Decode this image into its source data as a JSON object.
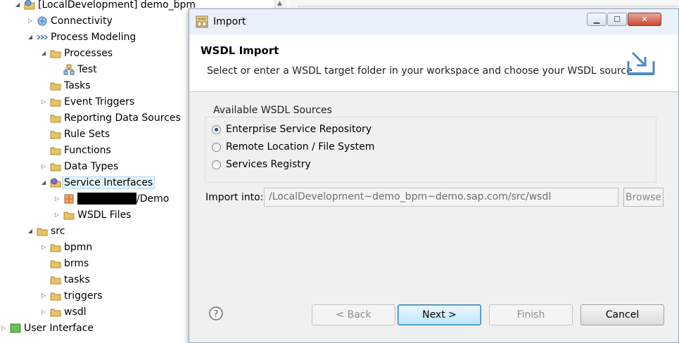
{
  "tree": {
    "items": [
      {
        "label": "[LocalDevelopment] demo_bpm",
        "icon": "project-icon",
        "twisty": "expanded"
      },
      {
        "label": "Connectivity",
        "icon": "connectivity-icon",
        "twisty": "collapsed"
      },
      {
        "label": "Process Modeling",
        "icon": "process-modeling-icon",
        "twisty": "expanded"
      },
      {
        "label": "Processes",
        "icon": "folder-icon",
        "twisty": "expanded"
      },
      {
        "label": "Test",
        "icon": "process-icon",
        "twisty": "none"
      },
      {
        "label": "Tasks",
        "icon": "folder-icon",
        "twisty": "none"
      },
      {
        "label": "Event Triggers",
        "icon": "folder-icon",
        "twisty": "collapsed"
      },
      {
        "label": "Reporting Data Sources",
        "icon": "folder-icon",
        "twisty": "none"
      },
      {
        "label": "Rule Sets",
        "icon": "folder-icon",
        "twisty": "none"
      },
      {
        "label": "Functions",
        "icon": "folder-icon",
        "twisty": "none"
      },
      {
        "label": "Data Types",
        "icon": "folder-icon",
        "twisty": "collapsed"
      },
      {
        "label": "Service Interfaces",
        "icon": "folder-icon",
        "twisty": "expanded",
        "selected": true
      },
      {
        "label": "/Demo",
        "icon": "package-icon",
        "twisty": "collapsed",
        "redacted": true
      },
      {
        "label": "WSDL Files",
        "icon": "folder-icon",
        "twisty": "collapsed"
      },
      {
        "label": "src",
        "icon": "folder-icon",
        "twisty": "expanded"
      },
      {
        "label": "bpmn",
        "icon": "folder-icon",
        "twisty": "collapsed"
      },
      {
        "label": "brms",
        "icon": "folder-icon",
        "twisty": "none"
      },
      {
        "label": "tasks",
        "icon": "folder-icon",
        "twisty": "none"
      },
      {
        "label": "triggers",
        "icon": "folder-icon",
        "twisty": "collapsed"
      },
      {
        "label": "wsdl",
        "icon": "folder-icon",
        "twisty": "collapsed"
      },
      {
        "label": "User Interface",
        "icon": "ui-icon",
        "twisty": "collapsed"
      }
    ]
  },
  "dialog": {
    "title": "Import",
    "header_title": "WSDL Import",
    "header_description": "Select or enter a WSDL target folder in your workspace and choose your WSDL source",
    "sources_legend": "Available WSDL Sources",
    "sources": [
      {
        "label": "Enterprise Service Repository",
        "selected": true
      },
      {
        "label": "Remote Location / File System",
        "selected": false
      },
      {
        "label": "Services Registry",
        "selected": false
      }
    ],
    "import_into_label": "Import into:",
    "import_into_value": "/LocalDevelopment~demo_bpm~demo.sap.com/src/wsdl",
    "browse_label": "Browse",
    "buttons": {
      "back": "< Back",
      "next": "Next >",
      "finish": "Finish",
      "cancel": "Cancel"
    }
  },
  "colors": {
    "selection_bg": "#e5f3fb",
    "folder": "#e8c266",
    "default_button": "#3c7fb1"
  }
}
